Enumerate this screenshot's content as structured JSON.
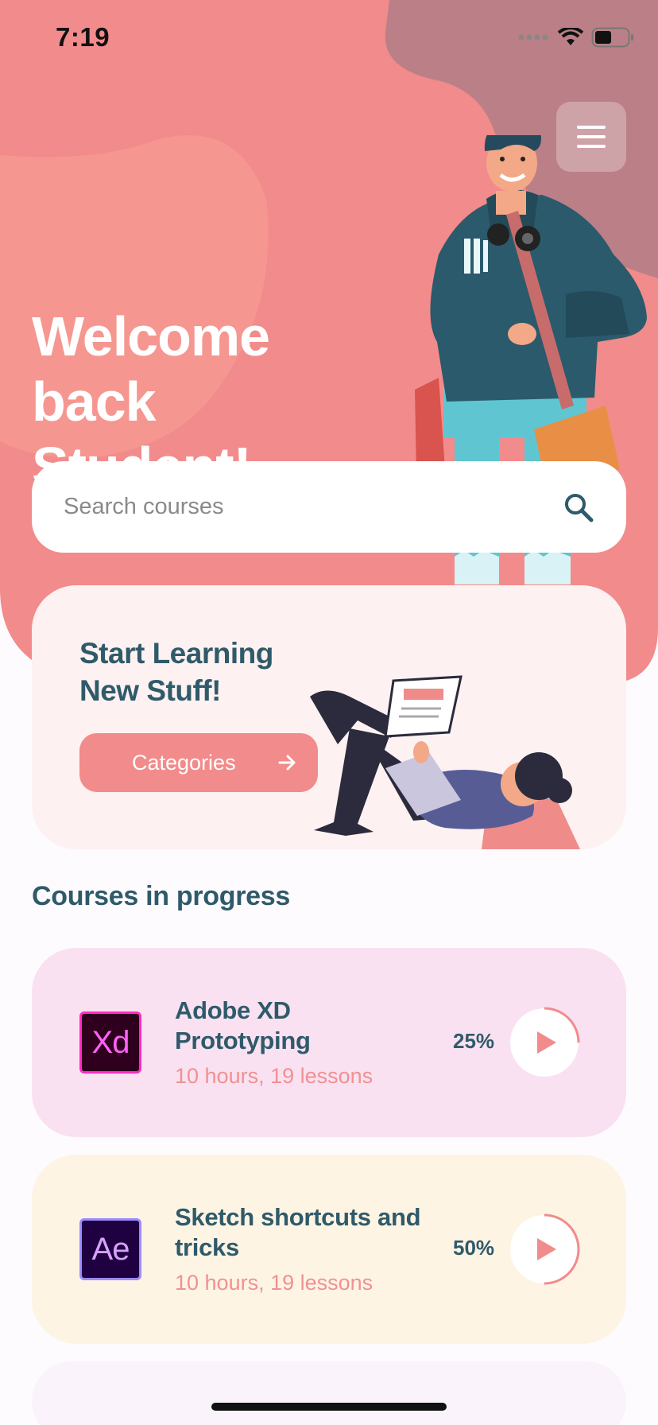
{
  "status_bar": {
    "time": "7:19"
  },
  "hero": {
    "welcome_line1": "Welcome back",
    "welcome_line2": "Student!"
  },
  "search": {
    "placeholder": "Search courses"
  },
  "promo": {
    "title_line1": "Start Learning",
    "title_line2": "New Stuff!",
    "button_label": "Categories"
  },
  "section": {
    "title": "Courses in progress"
  },
  "courses": [
    {
      "app_abbr": "Xd",
      "title_line1": "Adobe XD",
      "title_line2": "Prototyping",
      "meta": "10 hours, 19 lessons",
      "progress_label": "25%",
      "progress": 0.25
    },
    {
      "app_abbr": "Ae",
      "title_line1": "Sketch shortcuts and",
      "title_line2": "tricks",
      "meta": "10 hours, 19 lessons",
      "progress_label": "50%",
      "progress": 0.5
    }
  ],
  "colors": {
    "accent": "#f28b8b",
    "heading": "#2f5a6a",
    "xd_card": "#f9e1f1",
    "sketch_card": "#fef4e4"
  }
}
